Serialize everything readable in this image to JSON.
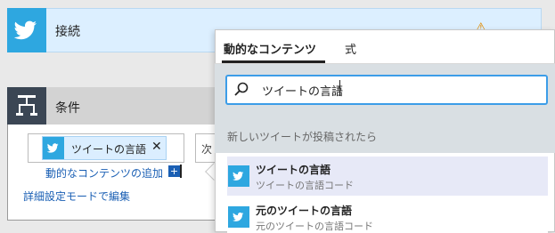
{
  "connection": {
    "title": "接続",
    "icon": "twitter-icon",
    "warning_icon": "warning-icon"
  },
  "condition": {
    "title": "条件",
    "icon": "condition-icon",
    "token_label": "ツイートの言語",
    "token_remove": "✕",
    "operator_partial": "次",
    "add_dynamic_label": "動的なコンテンツの追加",
    "add_dynamic_plus": "+",
    "advanced_mode_label": "詳細設定モードで編集"
  },
  "popup": {
    "tabs": [
      {
        "label": "動的なコンテンツ",
        "active": true
      },
      {
        "label": "式",
        "active": false
      }
    ],
    "search": {
      "value": "ツイートの言語",
      "icon": "search-icon"
    },
    "section_label": "新しいツイートが投稿されたら",
    "items": [
      {
        "title": "ツイートの言語",
        "subtitle": "ツイートの言語コード",
        "icon": "twitter-icon",
        "highlighted": true
      },
      {
        "title": "元のツイートの言語",
        "subtitle": "元のツイートの言語コード",
        "icon": "twitter-icon",
        "highlighted": false
      }
    ]
  },
  "colors": {
    "twitter_blue": "#2ea7e0",
    "link_blue": "#1a5fb4",
    "search_focus": "#3c9de8"
  }
}
